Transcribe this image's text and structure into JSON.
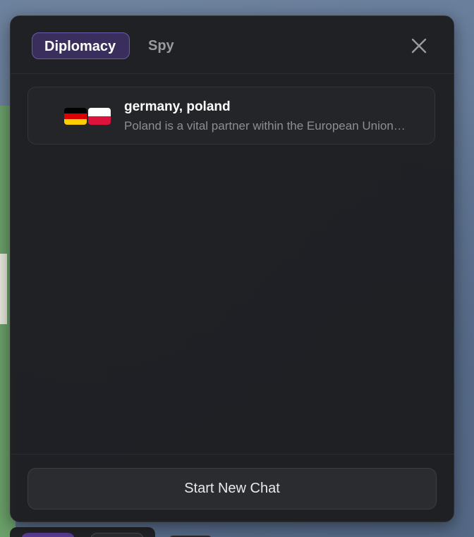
{
  "tabs": [
    {
      "label": "Diplomacy",
      "active": true
    },
    {
      "label": "Spy",
      "active": false
    }
  ],
  "chats": [
    {
      "title": "germany, poland",
      "preview": "Poland is a vital partner within the European Union…",
      "flags": [
        "germany-flag-icon",
        "poland-flag-icon"
      ]
    }
  ],
  "footer": {
    "start_chat_label": "Start New Chat"
  },
  "colors": {
    "accent": "#6b5aa6",
    "active_tab_bg": "#3a2f5c",
    "panel_bg": "#1c1d20"
  }
}
